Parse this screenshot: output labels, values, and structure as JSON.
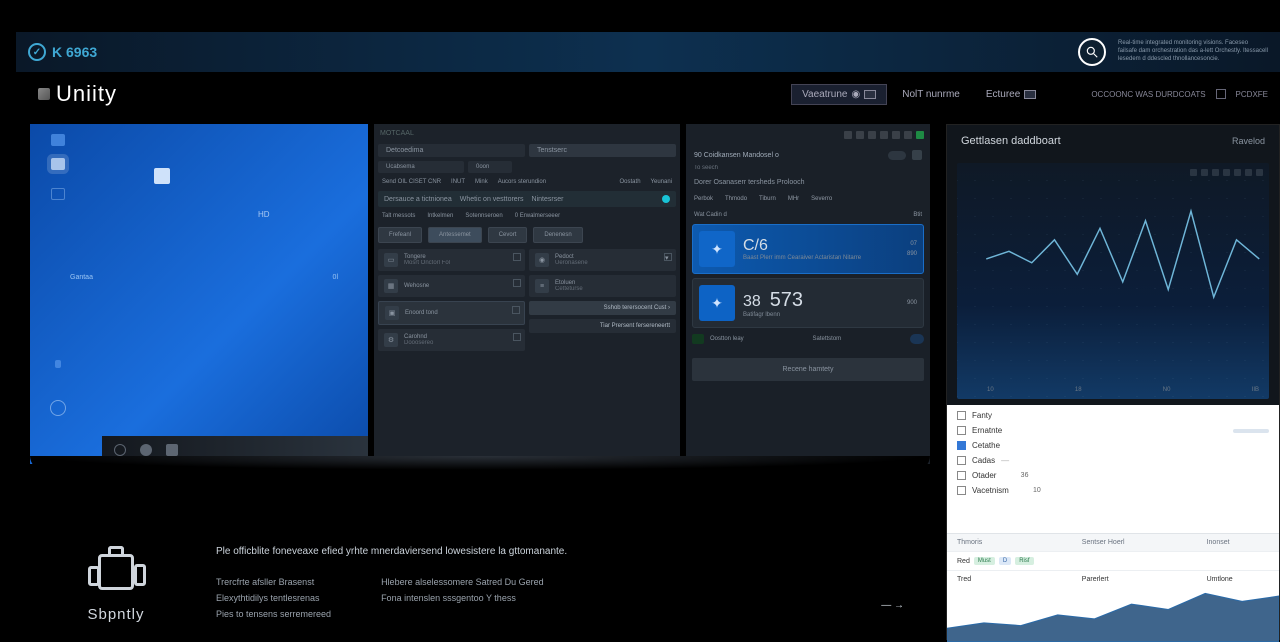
{
  "topbar": {
    "logo": "K 6963",
    "blurb": "Real-time integrated monitoring visions. Faceseo failsafe dam orchestration das a-lett Orchestly. Itessacell lesedem d ddescled thnollancesoncie."
  },
  "brand": {
    "name": "Uniity"
  },
  "nav": {
    "items": [
      "Vaeatrune",
      "NolT nunrme",
      "Ecturee"
    ],
    "right_label": "OCCOONC WAS DURDCOATS",
    "right_check": "PCDXFE"
  },
  "p1": {
    "label_a": "HD",
    "mid_left": "Gantaa",
    "mid_right": "0l"
  },
  "p2": {
    "top": "MOTCAAL",
    "chips": [
      "Detcoedima",
      "Tenstserc"
    ],
    "subchips": [
      "Ucabsema",
      "0oon"
    ],
    "tabs_l": [
      "Send OIL CISET CNR",
      "INUT",
      "Mink",
      "Aucors sterundion"
    ],
    "tabs_r": [
      "Oostath",
      "Yeunani"
    ],
    "hl": [
      "Dersauce a tictnionea",
      "Whetic on vesttorers",
      "Nintesrser"
    ],
    "row2": [
      "Talt messots",
      "Intkelmen",
      "Sotennseroen",
      "0    Erwalmerseeer"
    ],
    "btns": [
      "Frefeanl",
      "Antessemet",
      "Cevort",
      "Denenesn"
    ],
    "left_cards": [
      {
        "t": "Tongere",
        "s": "Mosrt Onctorl Fol"
      },
      {
        "t": "Wehosne",
        "s": ""
      },
      {
        "t": "Enoord tond",
        "s": ""
      },
      {
        "t": "Carohnd",
        "s": "Dooosereo"
      }
    ],
    "right_cards": [
      {
        "t": "Pedoct",
        "s": "Ueronasene"
      },
      {
        "t": "Etoluen",
        "s": "Cetteturse"
      }
    ],
    "right_links": [
      "Sshob terersocent Cust  ›",
      "Tiar Prersent fersereneertt"
    ]
  },
  "p3": {
    "title_a": "90 Coidkansen Mandosel o",
    "title_b": "To seech",
    "sub": "Dorer Osanaserr tersheds Prolooch",
    "tabs": [
      "Perbok",
      "Thmodo",
      "Tiburn",
      "MHr",
      "Severro"
    ],
    "date": "Wat Cadin d",
    "date_r": "Btit",
    "card1": {
      "v": "C/6",
      "sub": "Baast Plerr imm Cearaiver Actaristan Nitarre",
      "s1": "07",
      "s2": "890"
    },
    "card2": {
      "v_a": "38",
      "v_b": "573",
      "sub": "Batifagr lbenn",
      "s": "900"
    },
    "row": {
      "a": "Oostton leay",
      "b": "Satettstom"
    },
    "wide": "Recene hamtety"
  },
  "rp": {
    "title": "Gettlasen daddboart",
    "right": "Ravelod",
    "chart_data": {
      "type": "line",
      "series": [
        {
          "name": "trace",
          "values": [
            60,
            64,
            58,
            70,
            52,
            76,
            48,
            80,
            44,
            85,
            40,
            70,
            60
          ]
        }
      ],
      "xlim": [
        0,
        12
      ],
      "ylim": [
        0,
        100
      ],
      "xticks": [
        "10",
        "18",
        "N0",
        "IIB"
      ]
    },
    "list": [
      {
        "label": "Fanty",
        "on": false,
        "pct": 0
      },
      {
        "label": "Ernatnte",
        "on": false,
        "pct": 55
      },
      {
        "label": "Cetathe",
        "on": true,
        "pct": 0
      },
      {
        "label": "Cadas",
        "on": false,
        "pct": 0,
        "dash": true
      },
      {
        "label": "Otader",
        "on": false,
        "pct": 0,
        "val": "36"
      },
      {
        "label": "Vacetnism",
        "on": false,
        "pct": 0,
        "val": "10"
      }
    ],
    "thead": [
      "Thmoris",
      "Sentser Hoerl",
      "Inonset"
    ],
    "rows": [
      {
        "a": "Red",
        "tags": [
          "Must",
          "D",
          "Risf"
        ],
        "b": "",
        "c": ""
      },
      {
        "a": "Tred",
        "b": "Parerlert",
        "c": "Umtlone"
      }
    ],
    "chart_data2": {
      "type": "area",
      "values": [
        20,
        28,
        24,
        40,
        34,
        56,
        48,
        72,
        60,
        68
      ],
      "ylim": [
        0,
        80
      ]
    }
  },
  "bottom": {
    "brand": "Sbpntly",
    "headline": "Ple officblite foneveaxe efied yrhte mnerdaviersend lowesistere la gttomanante.",
    "col1": [
      "Trercfrte afsller Brasenst",
      "Elexythtidilys tentlesrenas",
      "Pies to tensens serremereed"
    ],
    "col2": [
      "Hlebere alselessomere Satred Du Gered",
      "Fona intenslen sssgentoo Y thess"
    ],
    "arrow": "— →"
  }
}
